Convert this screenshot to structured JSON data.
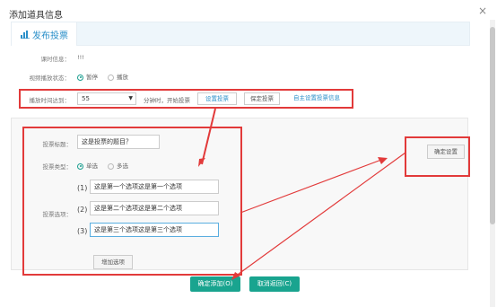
{
  "dialog": {
    "title": "添加道具信息",
    "close_glyph": "×"
  },
  "tabs": [
    {
      "label": "发布投票",
      "icon": "bar-chart-icon"
    }
  ],
  "info": {
    "course_label": "课时信息：",
    "course_value": "!!!",
    "video_state_label": "视频播放状态：",
    "video_state_options": [
      "暂停",
      "播放"
    ],
    "video_state_selected": "暂停"
  },
  "trigger": {
    "time_label": "播放时间达到：",
    "time_value": "55",
    "unit_text": "分钟时，开始投票",
    "set_vote_label": "设置投票",
    "save_vote_label": "保定投票",
    "custom_link": "自主设置投票信息"
  },
  "vote": {
    "title_label": "投票标题：",
    "title_value": "这是投票的题目？",
    "type_label": "投票类型：",
    "type_options": [
      "单选",
      "多选"
    ],
    "type_selected": "单选",
    "options_label": "投票选项：",
    "options": [
      {
        "num": "(1)",
        "text": "这是第一个选项这是第一个选项"
      },
      {
        "num": "(2)",
        "text": "这是第二个选项这是第二个选项"
      },
      {
        "num": "(3)",
        "text": "这是第三个选项这是第三个选项"
      }
    ],
    "add_option_label": "增加选项",
    "confirm_settings_label": "确定设置"
  },
  "footer": {
    "confirm_label": "确定添加(O)",
    "cancel_label": "取消返回(C)"
  },
  "colors": {
    "accent": "#19a48f",
    "annotation_red": "#e23a3a",
    "link_blue": "#2a8fc9"
  }
}
